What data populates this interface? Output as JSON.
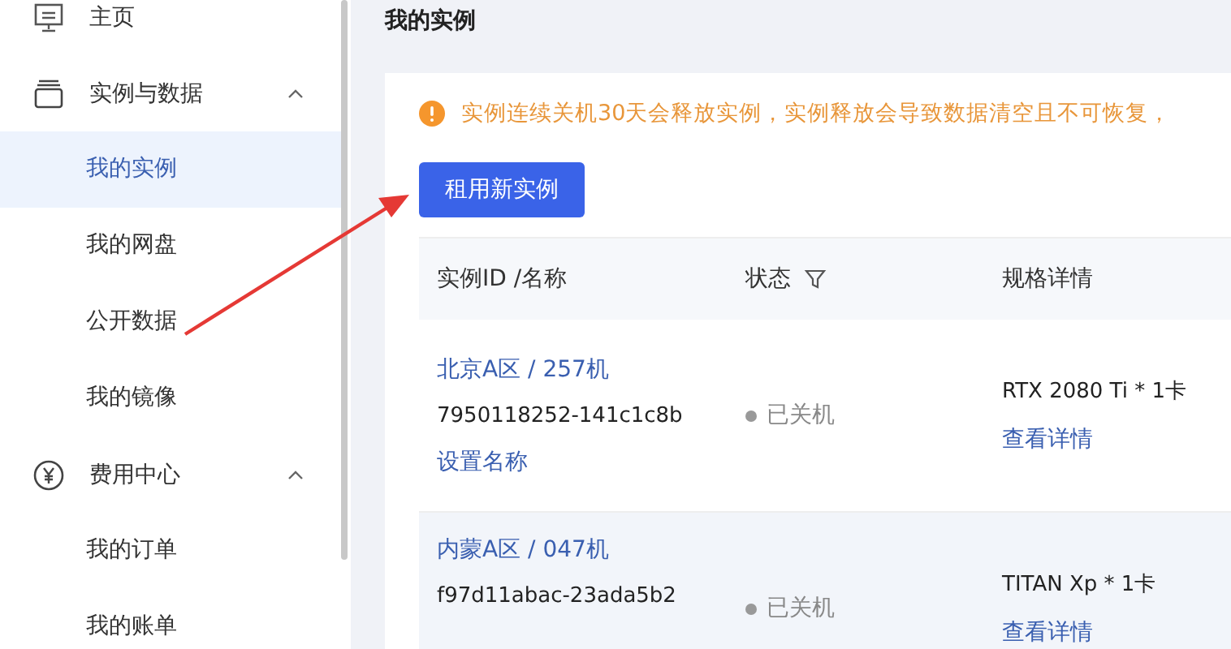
{
  "sidebar": {
    "items": [
      {
        "label": "主页",
        "selected": false
      },
      {
        "label": "实例与数据",
        "expanded": true,
        "selected": false,
        "children": [
          {
            "label": "我的实例",
            "selected": true
          },
          {
            "label": "我的网盘",
            "selected": false
          },
          {
            "label": "公开数据",
            "selected": false
          },
          {
            "label": "我的镜像",
            "selected": false
          }
        ]
      },
      {
        "label": "费用中心",
        "expanded": true,
        "selected": false,
        "children": [
          {
            "label": "我的订单",
            "selected": false
          },
          {
            "label": "我的账单",
            "selected": false
          }
        ]
      }
    ]
  },
  "page": {
    "title": "我的实例",
    "warning": "实例连续关机30天会释放实例，实例释放会导致数据清空且不可恢复，",
    "primary_button": "租用新实例"
  },
  "table": {
    "columns": [
      {
        "label": "实例ID /名称",
        "filter": false
      },
      {
        "label": "状态",
        "filter": true
      },
      {
        "label": "规格详情",
        "filter": false
      }
    ],
    "rows": [
      {
        "region": "北京A区 / 257机",
        "id": "7950118252-141c1c8b",
        "rename": "设置名称",
        "status": "已关机",
        "spec": "RTX 2080 Ti * 1卡",
        "details": "查看详情",
        "selected": false
      },
      {
        "region": "内蒙A区 / 047机",
        "id": "f97d11abac-23ada5b2",
        "status": "已关机",
        "spec": "TITAN Xp * 1卡",
        "details": "查看详情",
        "selected": true
      }
    ]
  },
  "annotation": {
    "kind": "arrow"
  }
}
